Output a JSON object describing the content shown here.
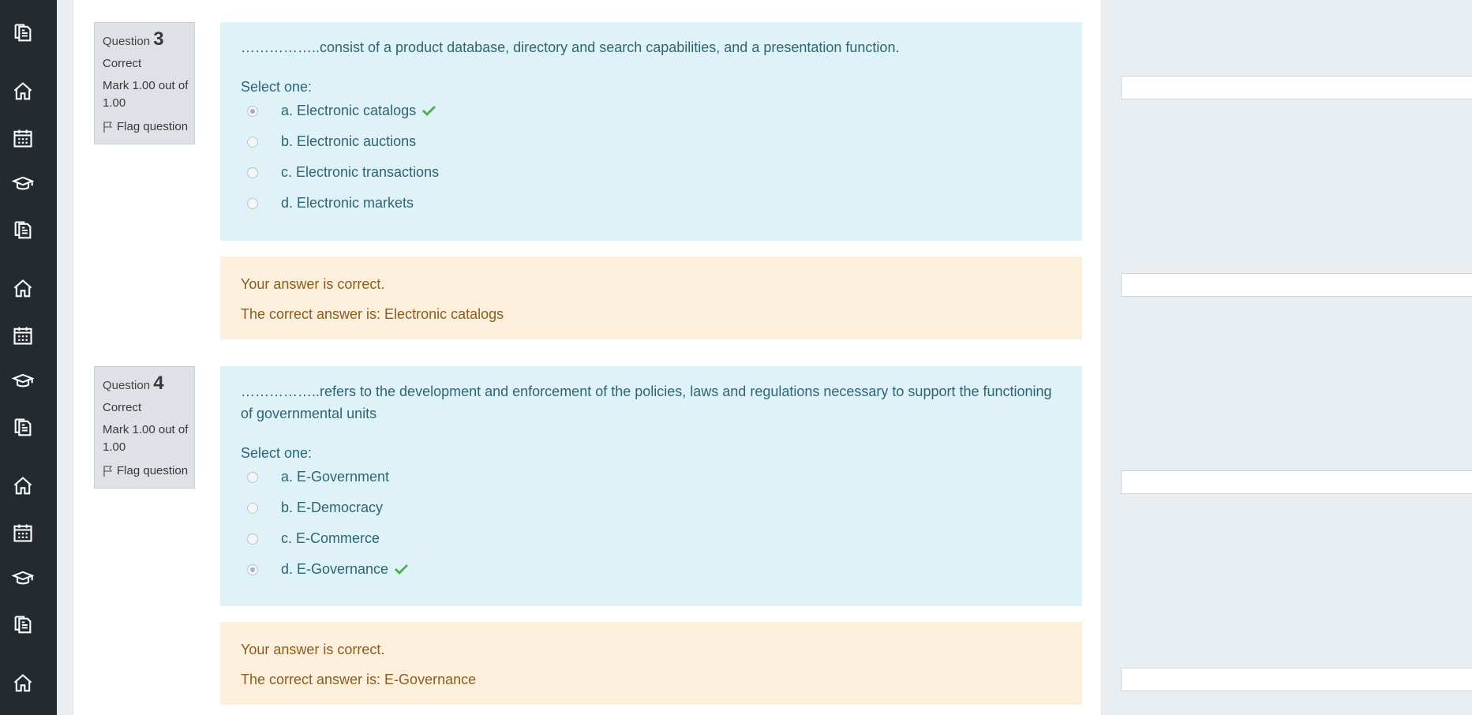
{
  "nav": {
    "icons": [
      "pages-icon",
      "home-icon",
      "calendar-icon",
      "graduation-cap-icon",
      "pages-icon",
      "home-icon",
      "calendar-icon",
      "graduation-cap-icon",
      "pages-icon",
      "home-icon",
      "calendar-icon",
      "graduation-cap-icon",
      "pages-icon",
      "home-icon"
    ]
  },
  "questions": [
    {
      "label": "Question",
      "number": "3",
      "state": "Correct",
      "grade": "Mark 1.00 out of 1.00",
      "flag_label": "Flag question",
      "text": "……………..consist of a product database, directory and search capabilities, and a presentation function.",
      "prompt": "Select one:",
      "answers": [
        {
          "label": "a. Electronic catalogs",
          "selected": true,
          "correct_mark": true
        },
        {
          "label": "b. Electronic auctions",
          "selected": false,
          "correct_mark": false
        },
        {
          "label": "c. Electronic transactions",
          "selected": false,
          "correct_mark": false
        },
        {
          "label": "d. Electronic markets",
          "selected": false,
          "correct_mark": false
        }
      ],
      "feedback_status": "Your answer is correct.",
      "feedback_answer": "The correct answer is: Electronic catalogs"
    },
    {
      "label": "Question",
      "number": "4",
      "state": "Correct",
      "grade": "Mark 1.00 out of 1.00",
      "flag_label": "Flag question",
      "text": "……………..refers to the development and enforcement of the policies, laws and regulations necessary to support the functioning of governmental units",
      "prompt": "Select one:",
      "answers": [
        {
          "label": "a. E-Government",
          "selected": false,
          "correct_mark": false
        },
        {
          "label": "b. E-Democracy",
          "selected": false,
          "correct_mark": false
        },
        {
          "label": "c. E-Commerce",
          "selected": false,
          "correct_mark": false
        },
        {
          "label": "d. E-Governance",
          "selected": true,
          "correct_mark": true
        }
      ],
      "feedback_status": "Your answer is correct.",
      "feedback_answer": "The correct answer is: E-Governance"
    }
  ],
  "colors": {
    "sidebar": "#232a30",
    "formulation_bg": "#def2f8",
    "feedback_bg": "#fcefdc",
    "check": "#4caf50"
  }
}
